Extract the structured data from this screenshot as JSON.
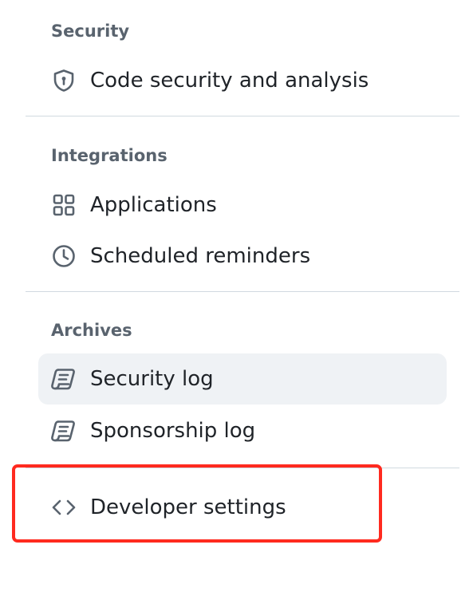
{
  "sections": {
    "security": {
      "heading": "Security",
      "items": [
        {
          "label": "Code security and analysis",
          "icon": "shield-lock-icon"
        }
      ]
    },
    "integrations": {
      "heading": "Integrations",
      "items": [
        {
          "label": "Applications",
          "icon": "apps-icon"
        },
        {
          "label": "Scheduled reminders",
          "icon": "clock-icon"
        }
      ]
    },
    "archives": {
      "heading": "Archives",
      "items": [
        {
          "label": "Security log",
          "icon": "log-icon",
          "selected": true
        },
        {
          "label": "Sponsorship log",
          "icon": "log-icon"
        }
      ]
    }
  },
  "developer": {
    "label": "Developer settings",
    "icon": "code-icon"
  },
  "colors": {
    "heading": "#59636e",
    "text": "#1f2328",
    "divider": "#d1d9e0",
    "selected_bg": "#eff2f5",
    "highlight": "#ff2a1f"
  }
}
